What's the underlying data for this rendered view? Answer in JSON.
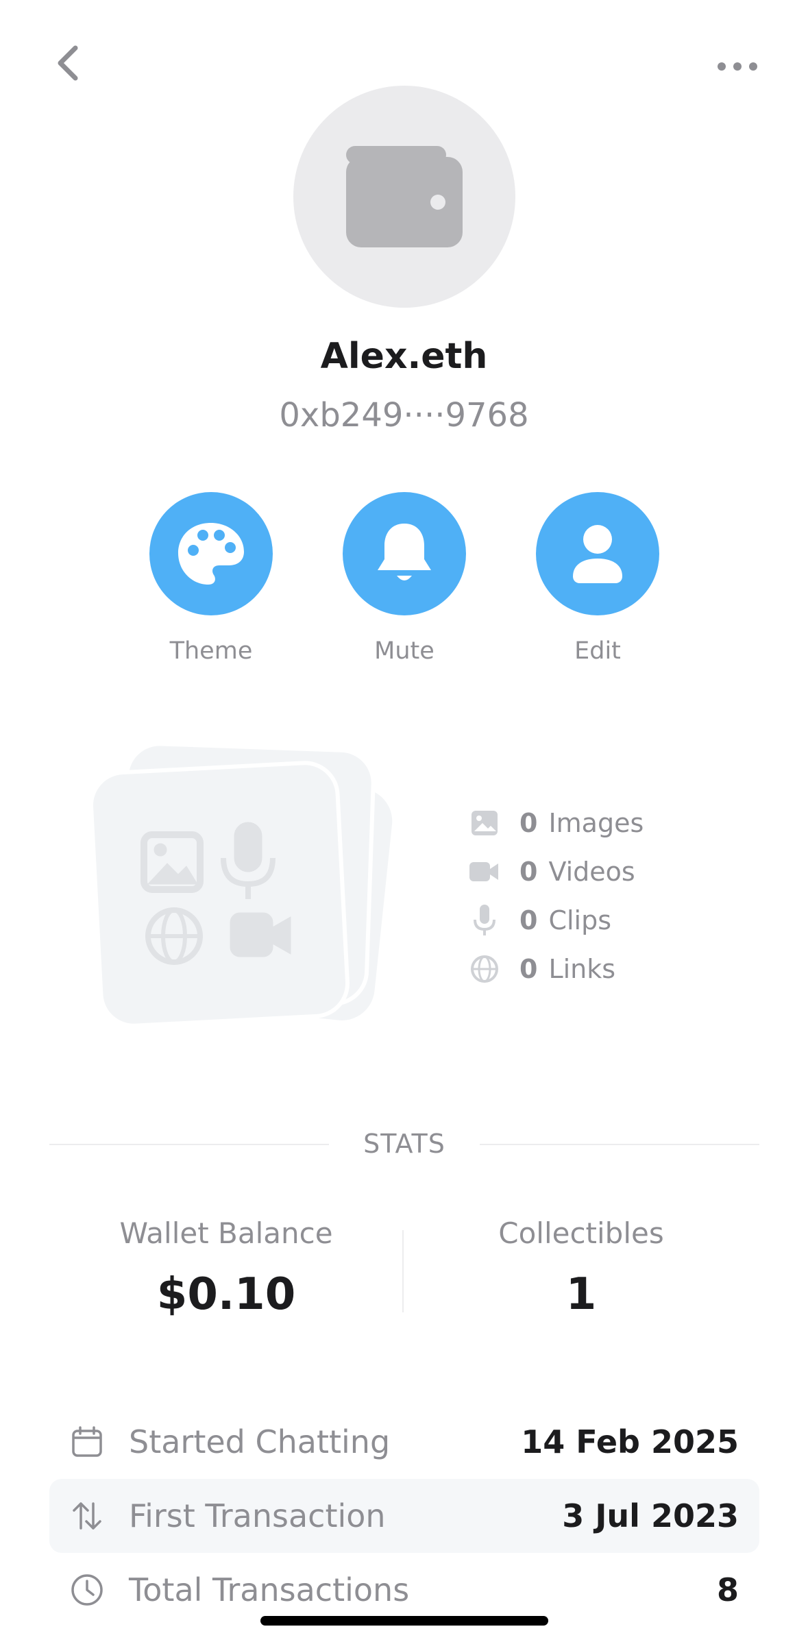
{
  "header": {
    "back_icon": "chevron-left-icon",
    "more_icon": "ellipsis-icon"
  },
  "profile": {
    "avatar_icon": "wallet-icon",
    "name": "Alex.eth",
    "address": "0xb249····9768"
  },
  "actions": [
    {
      "label": "Theme",
      "icon": "palette-icon"
    },
    {
      "label": "Mute",
      "icon": "bell-icon"
    },
    {
      "label": "Edit",
      "icon": "person-icon"
    }
  ],
  "media": [
    {
      "count": "0",
      "label": "Images",
      "icon": "image-icon"
    },
    {
      "count": "0",
      "label": "Videos",
      "icon": "video-icon"
    },
    {
      "count": "0",
      "label": "Clips",
      "icon": "mic-icon"
    },
    {
      "count": "0",
      "label": "Links",
      "icon": "globe-icon"
    }
  ],
  "stats": {
    "title": "STATS",
    "wallet_balance": {
      "label": "Wallet Balance",
      "value": "$0.10"
    },
    "collectibles": {
      "label": "Collectibles",
      "value": "1"
    }
  },
  "info": [
    {
      "label": "Started Chatting",
      "value": "14 Feb 2025",
      "icon": "calendar-icon"
    },
    {
      "label": "First Transaction",
      "value": "3 Jul 2023",
      "icon": "arrows-updown-icon"
    },
    {
      "label": "Total Transactions",
      "value": "8",
      "icon": "clock-icon"
    }
  ],
  "colors": {
    "accent": "#4fb0f6",
    "muted_text": "#8e8e93",
    "primary_text": "#1c1c1e",
    "avatar_bg": "#ebebed"
  }
}
